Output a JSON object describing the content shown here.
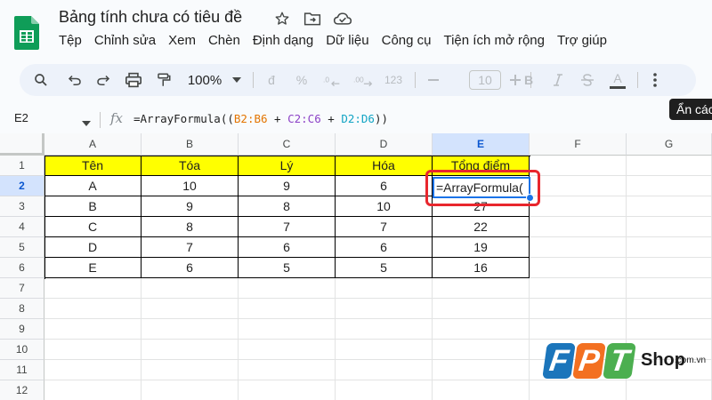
{
  "app": {
    "title": "Bảng tính chưa có tiêu đề",
    "menu": [
      "Tệp",
      "Chỉnh sửa",
      "Xem",
      "Chèn",
      "Định dạng",
      "Dữ liệu",
      "Công cụ",
      "Tiện ích mở rộng",
      "Trợ giúp"
    ]
  },
  "toolbar": {
    "zoom": "100%",
    "currency_symbol": "đ",
    "percent_symbol": "%",
    "number_format": "123",
    "font_size": "10",
    "bold": "B",
    "text_color": "A"
  },
  "tooltip": "Ẩn các",
  "formula_bar": {
    "cell_ref": "E2",
    "fx": "fx",
    "formula_parts": [
      "=ArrayFormula((",
      "B2:B6",
      " + ",
      "C2:C6",
      " + ",
      "D2:D6",
      "))"
    ]
  },
  "grid": {
    "columns": [
      "A",
      "B",
      "C",
      "D",
      "E",
      "F",
      "G"
    ],
    "rows": [
      "1",
      "2",
      "3",
      "4",
      "5",
      "6",
      "7",
      "8",
      "9",
      "10",
      "11",
      "12"
    ],
    "header_row": [
      "Tên",
      "Tóa",
      "Lý",
      "Hóa",
      "Tổng điểm"
    ],
    "data_rows": [
      [
        "A",
        "10",
        "9",
        "6",
        ""
      ],
      [
        "B",
        "9",
        "8",
        "10",
        "27"
      ],
      [
        "C",
        "8",
        "7",
        "7",
        "22"
      ],
      [
        "D",
        "7",
        "6",
        "6",
        "19"
      ],
      [
        "E",
        "6",
        "5",
        "5",
        "16"
      ]
    ],
    "editing_text": "=ArrayFormula(",
    "editing_caret_char": "("
  },
  "colors": {
    "header_fill": "#ffff00",
    "selection": "#1a73e8",
    "highlight": "#e8262d",
    "fpt_blue": "#1b75bb",
    "fpt_orange": "#f37021",
    "fpt_green": "#4caf50"
  },
  "watermark": {
    "letters": [
      "F",
      "P",
      "T"
    ],
    "shop": "Shop",
    "domain": ".com.vn"
  }
}
